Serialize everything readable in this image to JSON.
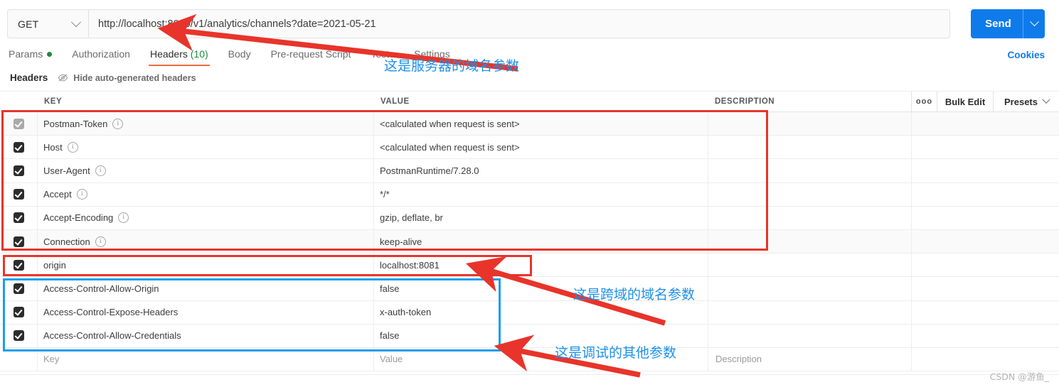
{
  "request": {
    "method": "GET",
    "url": "http://localhost:8080/v1/analytics/channels?date=2021-05-21",
    "send_label": "Send"
  },
  "tabs": [
    {
      "label": "Params",
      "has_dot": true
    },
    {
      "label": "Authorization",
      "has_dot": false
    },
    {
      "label": "Headers",
      "count": "(10)",
      "active": true
    },
    {
      "label": "Body",
      "has_dot": false
    },
    {
      "label": "Pre-request Script",
      "has_dot": false
    },
    {
      "label": "Tests",
      "has_dot": false
    },
    {
      "label": "Settings",
      "has_dot": false
    }
  ],
  "cookies_link": "Cookies",
  "subheader": {
    "title": "Headers",
    "hide_auto": "Hide auto-generated headers",
    "eye_icon": "eye-slash-icon"
  },
  "table": {
    "columns": [
      "KEY",
      "VALUE",
      "DESCRIPTION"
    ],
    "rows": [
      {
        "checked": true,
        "disabled": true,
        "info": true,
        "key": "Postman-Token",
        "value": "<calculated when request is sent>",
        "description": ""
      },
      {
        "checked": true,
        "disabled": false,
        "info": true,
        "key": "Host",
        "value": "<calculated when request is sent>",
        "description": ""
      },
      {
        "checked": true,
        "disabled": false,
        "info": true,
        "key": "User-Agent",
        "value": "PostmanRuntime/7.28.0",
        "description": ""
      },
      {
        "checked": true,
        "disabled": false,
        "info": true,
        "key": "Accept",
        "value": "*/*",
        "description": ""
      },
      {
        "checked": true,
        "disabled": false,
        "info": true,
        "key": "Accept-Encoding",
        "value": "gzip, deflate, br",
        "description": ""
      },
      {
        "checked": true,
        "disabled": false,
        "info": true,
        "key": "Connection",
        "value": "keep-alive",
        "description": ""
      },
      {
        "checked": true,
        "disabled": false,
        "info": false,
        "key": "origin",
        "value": "localhost:8081",
        "description": ""
      },
      {
        "checked": true,
        "disabled": false,
        "info": false,
        "key": "Access-Control-Allow-Origin",
        "value": "false",
        "description": ""
      },
      {
        "checked": true,
        "disabled": false,
        "info": false,
        "key": "Access-Control-Expose-Headers",
        "value": "x-auth-token",
        "description": ""
      },
      {
        "checked": true,
        "disabled": false,
        "info": false,
        "key": "Access-Control-Allow-Credentials",
        "value": "false",
        "description": ""
      }
    ],
    "placeholder_row": {
      "key": "Key",
      "value": "Value",
      "description": "Description"
    },
    "toolbar": {
      "more_label": "ooo",
      "bulk_edit_label": "Bulk Edit",
      "presets_label": "Presets"
    }
  },
  "annotations": {
    "text_1": "这是服务器的域名参数",
    "text_2": "这是跨域的域名参数",
    "text_3": "这是调试的其他参数",
    "red_color": "#e8342b",
    "blue_color": "#1a9eeb",
    "text_color": "#1e90e8"
  },
  "watermark": "CSDN @游鱼_"
}
